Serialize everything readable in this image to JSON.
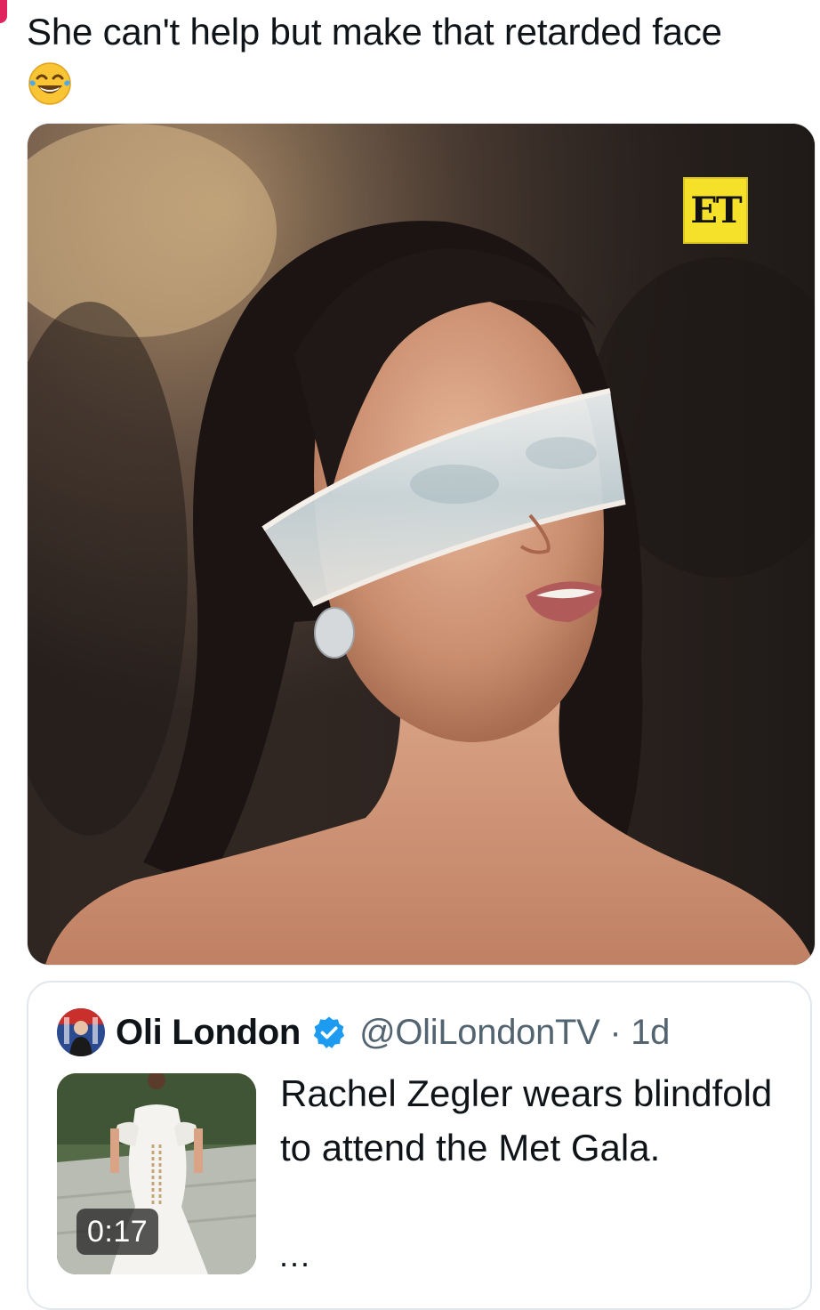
{
  "tweet": {
    "text": "She can't help but make that retarded face",
    "emoji": "face-with-tears-of-joy"
  },
  "media": {
    "watermark": "ET",
    "watermark_color": "#f5e02a"
  },
  "quoted_tweet": {
    "display_name": "Oli London",
    "verified": true,
    "handle_time": "@OliLondonTV · 1d",
    "text": "Rachel Zegler wears blindfold to attend the Met Gala.",
    "more": "...",
    "video_duration": "0:17",
    "verified_color": "#1d9bf0"
  }
}
